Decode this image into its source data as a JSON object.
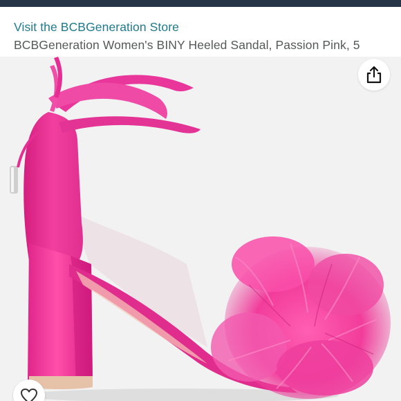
{
  "header": {
    "store_link": "Visit the BCBGeneration Store",
    "product_title": "BCBGeneration Women's BINY Heeled Sandal, Passion Pink, 5"
  },
  "colors": {
    "top_bar": "#253447",
    "link": "#1f7a8c",
    "title_text": "#565959",
    "image_background": "#f2f2f2",
    "product_pink": "#e5389a"
  },
  "icons": {
    "share": "share-icon",
    "wishlist": "heart-icon"
  }
}
